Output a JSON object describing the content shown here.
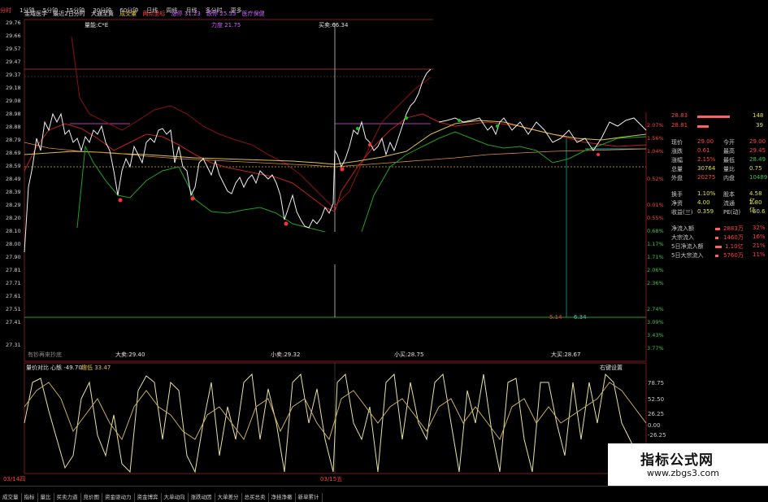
{
  "tabs": [
    "分时",
    "1分钟",
    "5分钟",
    "15分钟",
    "30分钟",
    "60分钟",
    "日线",
    "周线",
    "月线",
    "多分时",
    "更多"
  ],
  "info": {
    "name": "金域医学",
    "mode": "最近2日分时",
    "b1": "大通至黄",
    "b2": "成交量",
    "b3": "两点坐标",
    "b4": "涨停 31.23",
    "b5": "跌停 25.55",
    "b6": "医疗保健"
  },
  "chart_labels": {
    "liang": "量能:C*E",
    "lidu": "力度 21.75",
    "maimai": "买卖:66.34",
    "big_sell": "大卖:29.40",
    "small_sell": "小卖:29.32",
    "small_buy": "小买:28.75",
    "big_buy": "大买:28.67",
    "low_note": "有钞再来抄底",
    "v1": "6.34",
    "v2": "5.14"
  },
  "left_axis": [
    "29.76",
    "29.66",
    "29.57",
    "29.47",
    "29.37",
    "29.18",
    "29.08",
    "28.98",
    "28.88",
    "28.79",
    "28.69",
    "28.59",
    "28.49",
    "28.39",
    "28.29",
    "28.20",
    "28.10",
    "28.00",
    "27.90",
    "27.81",
    "27.71",
    "27.61",
    "27.51",
    "27.41",
    "27.31"
  ],
  "right_axis": [
    "2.07%",
    "1.56%",
    "1.04%",
    "0.52%",
    "0.01%",
    "0.55%",
    "0.68%",
    "1.17%",
    "1.71%",
    "2.06%",
    "2.36%",
    "2.74%",
    "3.09%",
    "3.43%",
    "3.77%"
  ],
  "lower_panel": {
    "title": "量价对比",
    "k1": "心態 -49.70",
    "k2": "趣低 33.47",
    "setting": "右键设置",
    "axis": [
      "78.75",
      "52.50",
      "26.25",
      "0.00",
      "-26.25"
    ],
    "date1": "03/14四",
    "date2": "03/15五"
  },
  "side": {
    "ask1_price": "28.83",
    "ask1_vol": "148",
    "bid1_price": "28.81",
    "bid1_vol": "39",
    "rows": [
      [
        "现价",
        "29.00",
        "今开",
        "29.00"
      ],
      [
        "涨跌",
        "0.61",
        "最高",
        "29.45"
      ],
      [
        "涨幅",
        "2.15%",
        "最低",
        "28.49"
      ],
      [
        "总量",
        "30764",
        "量比",
        "0.75"
      ],
      [
        "外盘",
        "20275",
        "内盘",
        "10489"
      ],
      [
        "换手",
        "1.10%",
        "股本",
        "4.58亿"
      ],
      [
        "净资",
        "4.00",
        "流通",
        "2.80亿"
      ],
      [
        "收益(三)",
        "0.359",
        "PE(动)",
        "60.6"
      ]
    ],
    "flows": [
      [
        "净流入额",
        "2883万",
        "32%"
      ],
      [
        "大宗流入",
        "1460万",
        "16%"
      ],
      [
        "5日净流入额",
        "1.10亿",
        "21%"
      ],
      [
        "5日大宗流入",
        "5760万",
        "11%"
      ]
    ]
  },
  "bottom_tabs": [
    "成交量",
    "指标",
    "量比",
    "买卖力道",
    "竞价图",
    "资金驱动力",
    "资金博弈",
    "大单动向",
    "涨跌动因",
    "大单差分",
    "总买总卖",
    "净挂净撤",
    "新单累计"
  ],
  "watermark": {
    "title": "指标公式网",
    "url": "www.zbgs3.com"
  },
  "colors": {
    "up": "#ff3030",
    "price": "#ffffff",
    "avg": "#e0c040",
    "green": "#20a020",
    "darkred": "#8a1010"
  }
}
